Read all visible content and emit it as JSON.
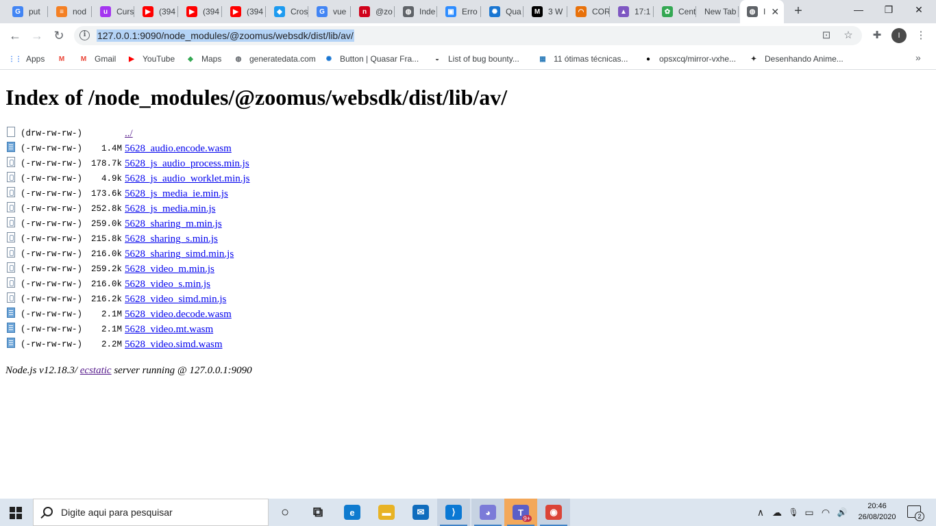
{
  "tabs": [
    {
      "title": "put",
      "favicon": "google-g-icon",
      "color": "#4285f4",
      "glyph": "G"
    },
    {
      "title": "nod",
      "favicon": "stack-icon",
      "color": "#f48024",
      "glyph": "≡"
    },
    {
      "title": "Curs",
      "favicon": "udemy-icon",
      "color": "#a435f0",
      "glyph": "u"
    },
    {
      "title": "(394",
      "favicon": "youtube-icon",
      "color": "#ff0000",
      "glyph": "▶"
    },
    {
      "title": "(394",
      "favicon": "youtube-icon",
      "color": "#ff0000",
      "glyph": "▶"
    },
    {
      "title": "(394",
      "favicon": "youtube-icon",
      "color": "#ff0000",
      "glyph": "▶"
    },
    {
      "title": "Cros",
      "favicon": "bird-icon",
      "color": "#1d9bf0",
      "glyph": "◆"
    },
    {
      "title": "vue",
      "favicon": "google-g-icon",
      "color": "#4285f4",
      "glyph": "G"
    },
    {
      "title": "@zo",
      "favicon": "n-icon",
      "color": "#d0021b",
      "glyph": "n"
    },
    {
      "title": "Inde",
      "favicon": "globe-icon",
      "color": "#5f6368",
      "glyph": "◍"
    },
    {
      "title": "Erro",
      "favicon": "zoom-icon",
      "color": "#2d8cff",
      "glyph": "▣"
    },
    {
      "title": "Qua",
      "favicon": "quasar-icon",
      "color": "#1976d2",
      "glyph": "✺"
    },
    {
      "title": "3 W",
      "favicon": "medium-icon",
      "color": "#000000",
      "glyph": "M"
    },
    {
      "title": "COR",
      "favicon": "rainbow-icon",
      "color": "#e8710a",
      "glyph": "◠"
    },
    {
      "title": "17:1",
      "favicon": "triangle-icon",
      "color": "#7e57c2",
      "glyph": "▲"
    },
    {
      "title": "Cent",
      "favicon": "flower-icon",
      "color": "#34a853",
      "glyph": "✿"
    },
    {
      "title": "New Tab",
      "favicon": "",
      "color": "",
      "glyph": ""
    },
    {
      "title": "I",
      "favicon": "globe-icon",
      "color": "#5f6368",
      "glyph": "◍"
    }
  ],
  "window": {
    "minimize": "—",
    "maximize": "❐",
    "close": "✕",
    "new_tab": "+"
  },
  "toolbar": {
    "back": "←",
    "forward": "→",
    "reload": "↻",
    "info_glyph": "i",
    "url": "127.0.0.1:9090/node_modules/@zoomus/websdk/dist/lib/av/",
    "cast_glyph": "⊡",
    "star_glyph": "☆",
    "extensions_glyph": "✚",
    "profile_initial": "I",
    "menu_glyph": "⋮"
  },
  "bookmarks": [
    {
      "label": "Apps",
      "icon": "apps-grid-icon",
      "color": "#4285f4",
      "glyph": "⋮⋮"
    },
    {
      "label": "",
      "icon": "gmail-icon",
      "color": "#ea4335",
      "glyph": "M"
    },
    {
      "label": "Gmail",
      "icon": "gmail-icon",
      "color": "#ea4335",
      "glyph": "M"
    },
    {
      "label": "YouTube",
      "icon": "youtube-icon",
      "color": "#ff0000",
      "glyph": "▶"
    },
    {
      "label": "Maps",
      "icon": "maps-pin-icon",
      "color": "#34a853",
      "glyph": "◆"
    },
    {
      "label": "generatedata.com",
      "icon": "globe-icon",
      "color": "#5f6368",
      "glyph": "◍"
    },
    {
      "label": "Button | Quasar Fra...",
      "icon": "quasar-icon",
      "color": "#1976d2",
      "glyph": "✺"
    },
    {
      "label": "List of bug bounty...",
      "icon": "car-icon",
      "color": "#555555",
      "glyph": "◒"
    },
    {
      "label": "11 ótimas técnicas...",
      "icon": "cube-icon",
      "color": "#2b7bb9",
      "glyph": "▦"
    },
    {
      "label": "opsxcq/mirror-vxhe...",
      "icon": "github-icon",
      "color": "#000000",
      "glyph": "●"
    },
    {
      "label": "Desenhando Anime...",
      "icon": "puzzle-icon",
      "color": "#222222",
      "glyph": "✦"
    }
  ],
  "bookmarks_more": "»",
  "page": {
    "heading": "Index of /node_modules/@zoomus/websdk/dist/lib/av/",
    "entries": [
      {
        "perm": "(drw-rw-rw-)",
        "size": "",
        "name": "../",
        "kind": "dir"
      },
      {
        "perm": "(-rw-rw-rw-)",
        "size": "1.4M",
        "name": "5628_audio.encode.wasm",
        "kind": "bin"
      },
      {
        "perm": "(-rw-rw-rw-)",
        "size": "178.7k",
        "name": "5628_js_audio_process.min.js",
        "kind": "js"
      },
      {
        "perm": "(-rw-rw-rw-)",
        "size": "4.9k",
        "name": "5628_js_audio_worklet.min.js",
        "kind": "js"
      },
      {
        "perm": "(-rw-rw-rw-)",
        "size": "173.6k",
        "name": "5628_js_media_ie.min.js",
        "kind": "js"
      },
      {
        "perm": "(-rw-rw-rw-)",
        "size": "252.8k",
        "name": "5628_js_media.min.js",
        "kind": "js"
      },
      {
        "perm": "(-rw-rw-rw-)",
        "size": "259.0k",
        "name": "5628_sharing_m.min.js",
        "kind": "js"
      },
      {
        "perm": "(-rw-rw-rw-)",
        "size": "215.8k",
        "name": "5628_sharing_s.min.js",
        "kind": "js"
      },
      {
        "perm": "(-rw-rw-rw-)",
        "size": "216.0k",
        "name": "5628_sharing_simd.min.js",
        "kind": "js"
      },
      {
        "perm": "(-rw-rw-rw-)",
        "size": "259.2k",
        "name": "5628_video_m.min.js",
        "kind": "js"
      },
      {
        "perm": "(-rw-rw-rw-)",
        "size": "216.0k",
        "name": "5628_video_s.min.js",
        "kind": "js"
      },
      {
        "perm": "(-rw-rw-rw-)",
        "size": "216.2k",
        "name": "5628_video_simd.min.js",
        "kind": "js"
      },
      {
        "perm": "(-rw-rw-rw-)",
        "size": "2.1M",
        "name": "5628_video.decode.wasm",
        "kind": "bin"
      },
      {
        "perm": "(-rw-rw-rw-)",
        "size": "2.1M",
        "name": "5628_video.mt.wasm",
        "kind": "bin"
      },
      {
        "perm": "(-rw-rw-rw-)",
        "size": "2.2M",
        "name": "5628_video.simd.wasm",
        "kind": "bin"
      }
    ],
    "footer": {
      "prefix": "Node.js v12.18.3/ ",
      "link": "ecstatic",
      "suffix": " server running @ 127.0.0.1:9090"
    }
  },
  "taskbar": {
    "search_placeholder": "Digite aqui para pesquisar",
    "apps": [
      {
        "name": "cortana-icon",
        "glyph": "○",
        "color": "#222222",
        "running": false
      },
      {
        "name": "task-view-icon",
        "glyph": "⧉",
        "color": "#222222",
        "running": false
      },
      {
        "name": "edge-icon",
        "glyph": "e",
        "color": "#0f7bcf",
        "running": false
      },
      {
        "name": "file-explorer-icon",
        "glyph": "▬",
        "color": "#e8b325",
        "running": false
      },
      {
        "name": "mail-icon",
        "glyph": "✉",
        "color": "#0f6cbd",
        "running": false
      },
      {
        "name": "vscode-icon",
        "glyph": "⟩",
        "color": "#0a78d4",
        "running": true
      },
      {
        "name": "discord-icon",
        "glyph": "◕",
        "color": "#7b7bd8",
        "running": true
      },
      {
        "name": "teams-icon",
        "glyph": "T",
        "color": "#5b5fc7",
        "running": true,
        "badge": "9+"
      },
      {
        "name": "chrome-icon",
        "glyph": "◉",
        "color": "#db4437",
        "running": true
      }
    ],
    "tray": {
      "chevron": "∧",
      "cloud": "☁",
      "mic": "🎙",
      "battery": "▭",
      "wifi": "◠",
      "volume": "🔊"
    },
    "time": "20:46",
    "date": "26/08/2020",
    "notifications": "2"
  }
}
